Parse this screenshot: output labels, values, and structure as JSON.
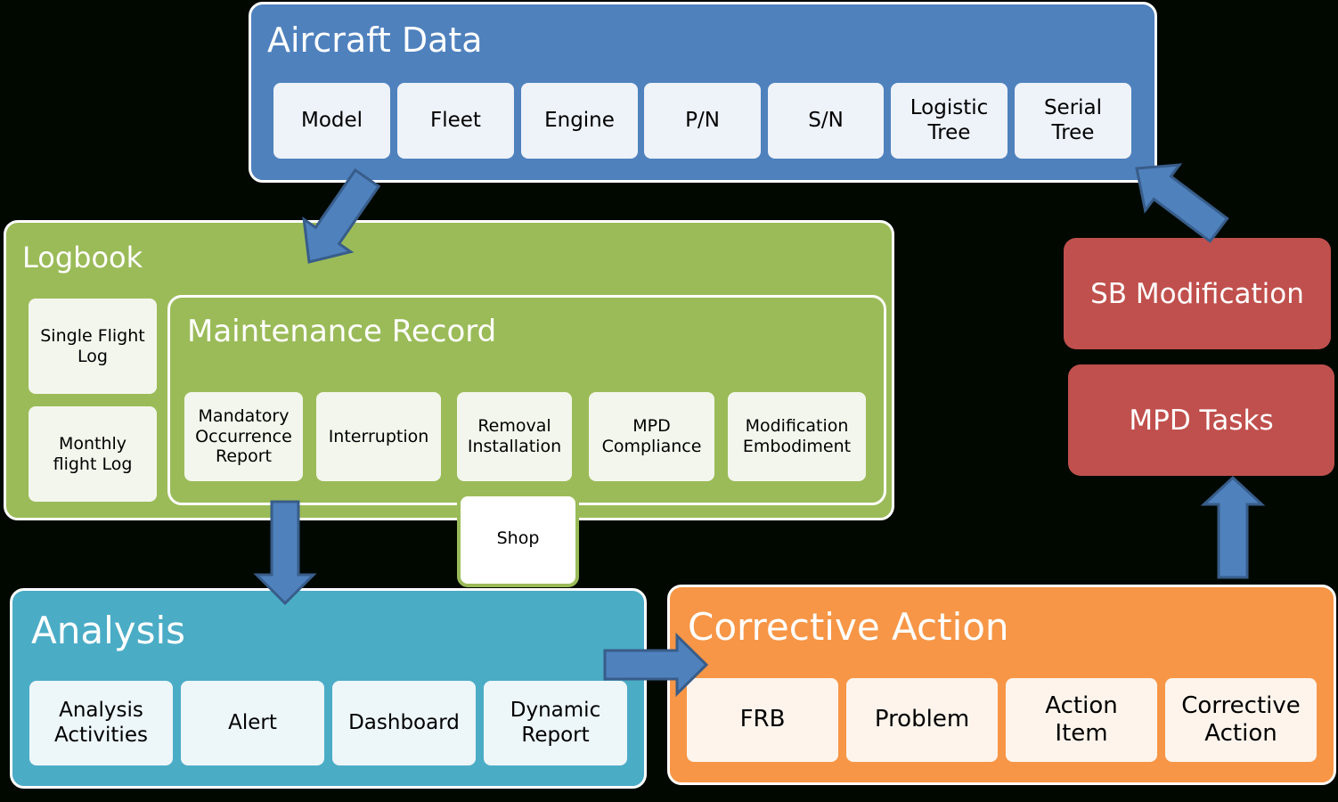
{
  "aircraft_data": {
    "title": "Aircraft Data",
    "items": [
      "Model",
      "Fleet",
      "Engine",
      "P/N",
      "S/N",
      "Logistic Tree",
      "Serial Tree"
    ]
  },
  "logbook": {
    "title": "Logbook",
    "items": [
      "Single Flight Log",
      "Monthly flight Log"
    ]
  },
  "maintenance_record": {
    "title": "Maintenance Record",
    "items": [
      "Mandatory Occurrence Report",
      "Interruption",
      "Removal Installation",
      "MPD Compliance",
      "Modification Embodiment"
    ],
    "shop": "Shop"
  },
  "analysis": {
    "title": "Analysis",
    "items": [
      "Analysis Activities",
      "Alert",
      "Dashboard",
      "Dynamic Report"
    ]
  },
  "corrective_action": {
    "title": "Corrective Action",
    "items": [
      "FRB",
      "Problem",
      "Action Item",
      "Corrective Action"
    ]
  },
  "sb_modification": "SB Modification",
  "mpd_tasks": "MPD Tasks",
  "colors": {
    "aircraft_data": "#4f81bd",
    "logbook": "#9bbb59",
    "analysis": "#4bacc6",
    "corrective_action": "#f79646",
    "tasks": "#c0504d",
    "arrow": "#4f81bd"
  }
}
